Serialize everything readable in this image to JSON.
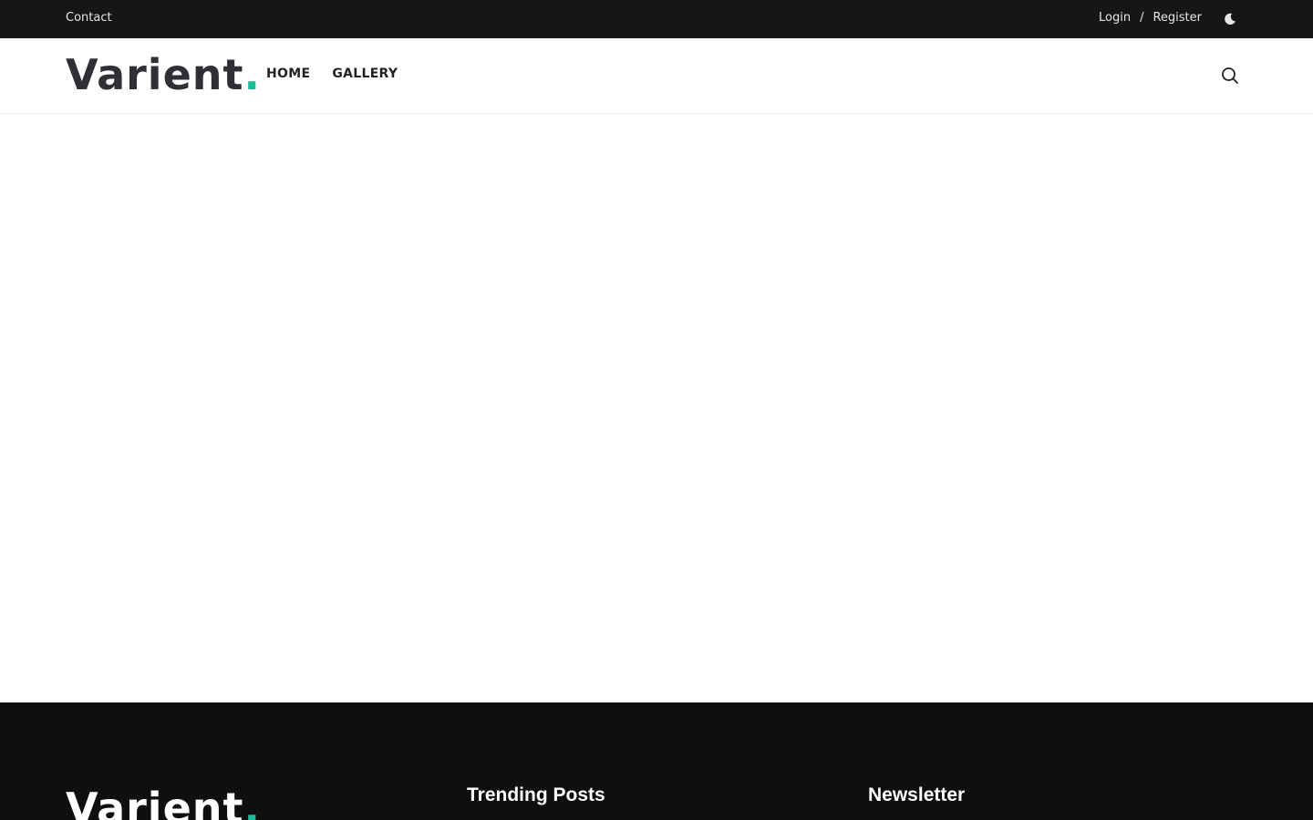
{
  "topbar": {
    "contact_label": "Contact",
    "login_label": "Login",
    "separator": "/",
    "register_label": "Register",
    "theme_toggle_icon": "moon-icon"
  },
  "header": {
    "logo_text": "Varient",
    "logo_dot": ".",
    "nav": {
      "home_label": "HOME",
      "gallery_label": "GALLERY"
    },
    "search_icon": "search-icon"
  },
  "footer": {
    "logo_text": "Varient",
    "logo_dot": ".",
    "trending_title": "Trending Posts",
    "newsletter_title": "Newsletter"
  },
  "colors": {
    "topbar_bg": "#161616",
    "footer_bg": "#0f0f0f",
    "accent": "#1abc9c",
    "logo_text": "#2f3036"
  }
}
